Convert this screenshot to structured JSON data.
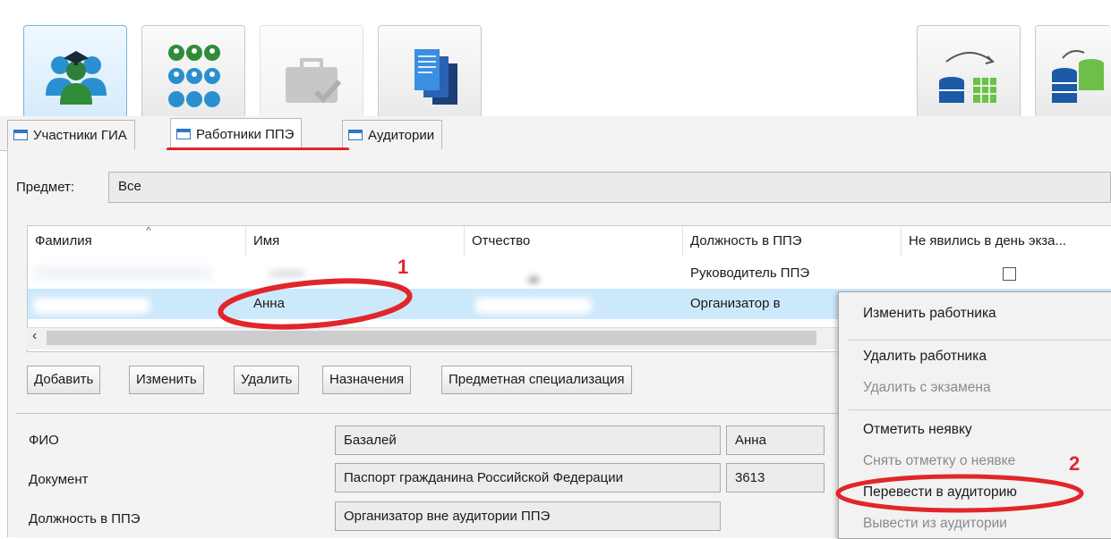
{
  "toolbar": {
    "buttons": [
      {
        "icon": "participants-icon",
        "state": "active"
      },
      {
        "icon": "people-grid-icon",
        "state": "normal"
      },
      {
        "icon": "briefcase-check-icon",
        "state": "disabled"
      },
      {
        "icon": "documents-icon",
        "state": "normal"
      },
      {
        "icon": "database-exchange-icon",
        "state": "normal"
      },
      {
        "icon": "database-sync-icon",
        "state": "normal"
      }
    ]
  },
  "tabs": [
    {
      "label": "Участники ГИА",
      "active": false
    },
    {
      "label": "Работники ППЭ",
      "active": true
    },
    {
      "label": "Аудитории",
      "active": false
    }
  ],
  "filter": {
    "subject_label": "Предмет:",
    "subject_value": "Все"
  },
  "grid": {
    "columns": [
      "Фамилия",
      "Имя",
      "Отчество",
      "Должность в ППЭ",
      "Не явились в день экза..."
    ],
    "rows": [
      {
        "surname": "",
        "name": "",
        "patronymic": "",
        "position": "Руководитель ППЭ",
        "absent": false
      },
      {
        "surname": "",
        "name": "Анна",
        "patronymic": "",
        "position": "Организатор в",
        "absent": false,
        "selected": true
      },
      {
        "surname": "",
        "name": "",
        "patronymic": "",
        "position": "",
        "absent": false
      }
    ]
  },
  "actions": {
    "add": "Добавить",
    "edit": "Изменить",
    "delete": "Удалить",
    "assignments": "Назначения",
    "specialization": "Предметная специализация"
  },
  "details": {
    "fio_label": "ФИО",
    "fio_surname": "Базалей",
    "fio_name": "Анна",
    "doc_label": "Документ",
    "doc_type": "Паспорт гражданина Российской Федерации",
    "doc_series": "3613",
    "position_label": "Должность в ППЭ",
    "position_value": "Организатор вне аудитории ППЭ"
  },
  "context_menu": {
    "edit_worker": "Изменить работника",
    "delete_worker": "Удалить работника",
    "remove_from_exam": "Удалить с экзамена",
    "mark_absence": "Отметить неявку",
    "unmark_absence": "Снять отметку о неявке",
    "move_to_room": "Перевести в аудиторию",
    "remove_from_room": "Вывести из аудитории"
  },
  "annotations": {
    "step1": "1",
    "step2": "2",
    "highlight_color": "#e0262a"
  }
}
